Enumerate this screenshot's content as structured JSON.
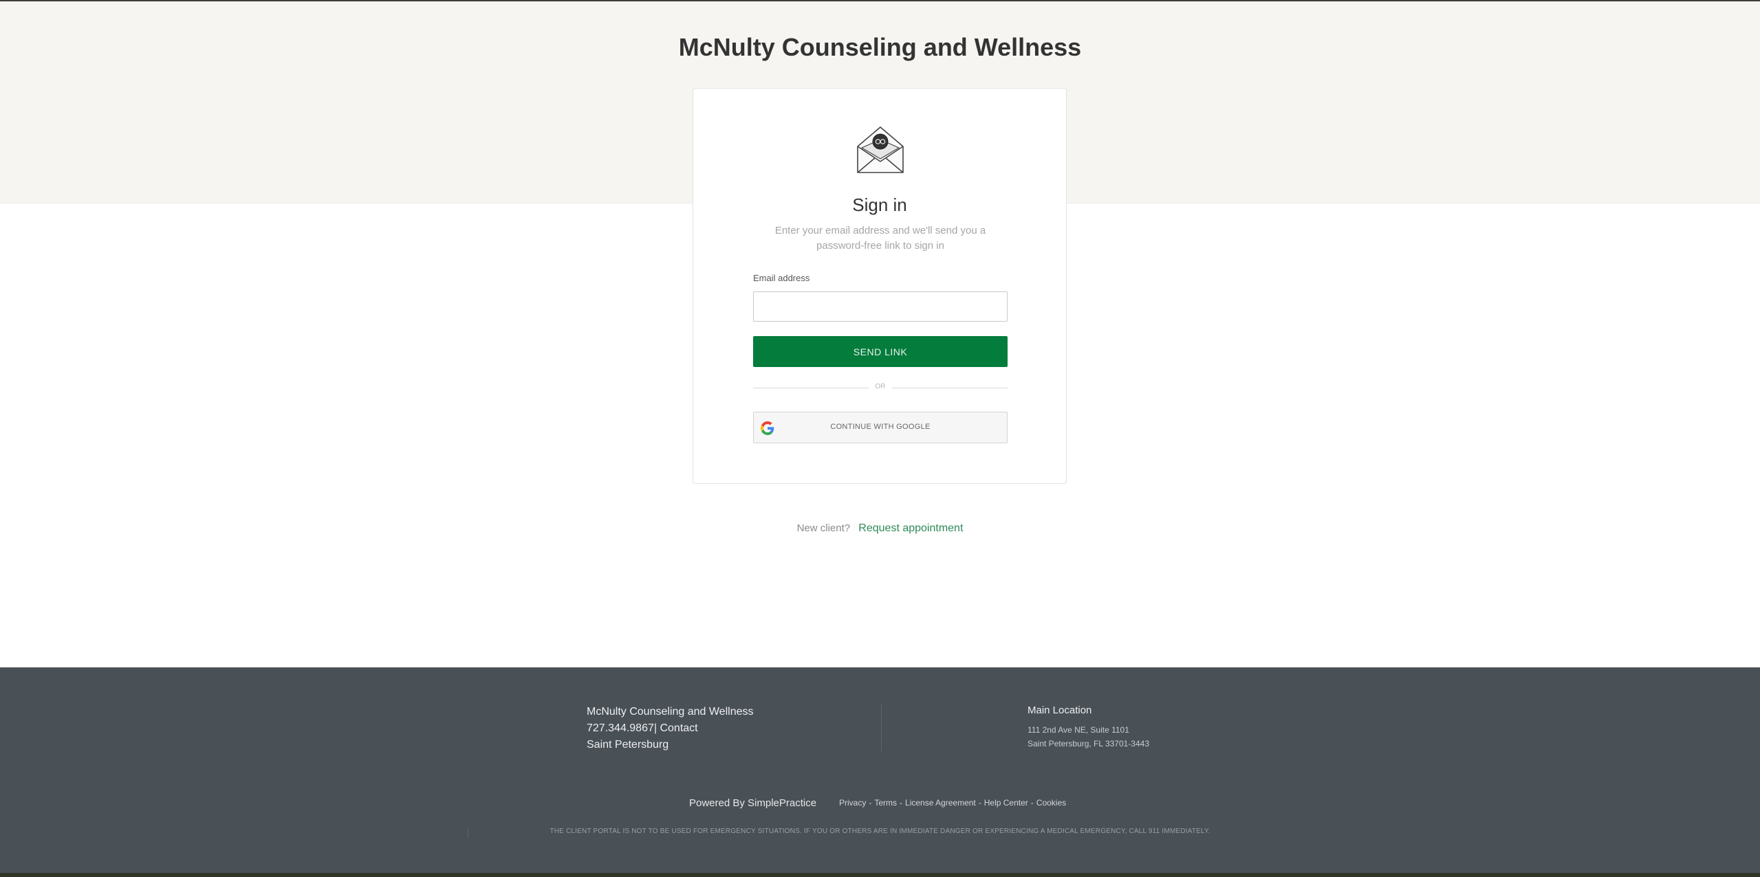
{
  "header": {
    "practice_name": "McNulty Counseling and Wellness"
  },
  "signin": {
    "title": "Sign in",
    "subtitle": "Enter your email address and we'll send you a password-free link to sign in",
    "email_label": "Email address",
    "email_value": "",
    "email_placeholder": "",
    "send_button": "SEND LINK",
    "or_text": "OR",
    "google_button": "CONTINUE WITH GOOGLE"
  },
  "new_client": {
    "label": "New client?",
    "link": "Request appointment"
  },
  "footer": {
    "practice_name": "McNulty Counseling and Wellness",
    "phone": "727.344.9867",
    "contact": "| Contact",
    "city": "Saint Petersburg",
    "location_title": "Main Location",
    "address_line1": "111 2nd Ave NE, Suite 1101",
    "address_line2": "Saint Petersburg, FL 33701-3443",
    "powered_by": "Powered By SimplePractice",
    "links": {
      "privacy": "Privacy",
      "terms": "Terms",
      "license": "License Agreement",
      "help": "Help Center",
      "cookies": "Cookies"
    },
    "disclaimer": "THE CLIENT PORTAL IS NOT TO BE USED FOR EMERGENCY SITUATIONS. IF YOU OR OTHERS ARE IN IMMEDIATE DANGER OR EXPERIENCING A MEDICAL EMERGENCY, CALL 911 IMMEDIATELY."
  },
  "icons": {
    "envelope": "envelope-with-logo-icon",
    "google": "google-g-icon"
  },
  "colors": {
    "primary_green": "#047c3c",
    "link_green": "#2f8a57",
    "header_band": "#f6f5f1",
    "footer_bg": "#495056"
  }
}
